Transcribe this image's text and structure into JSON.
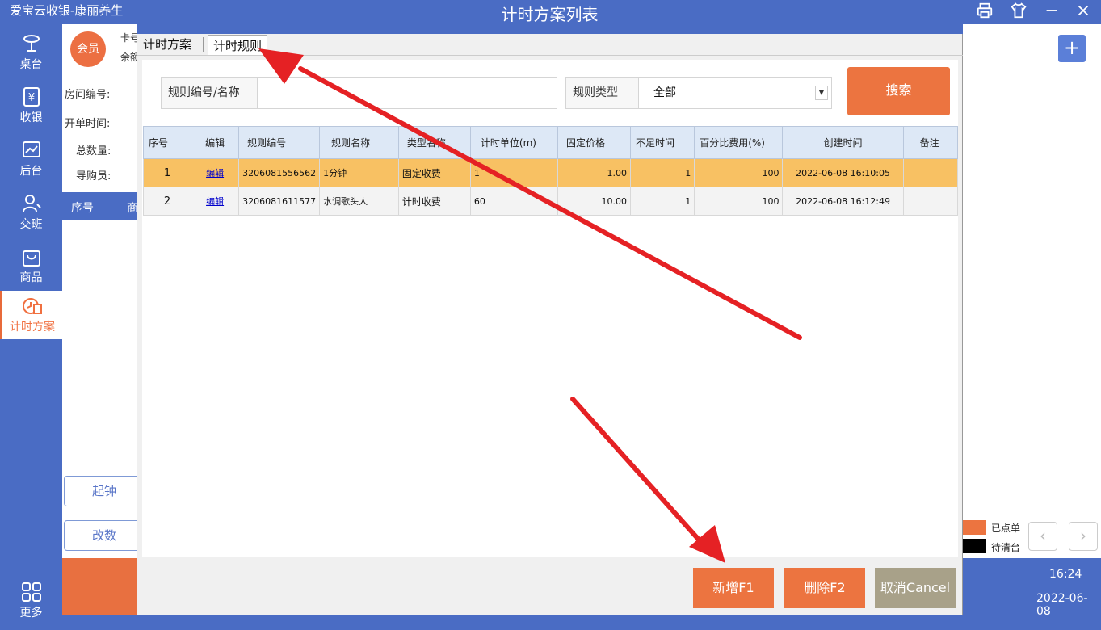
{
  "app_title": "爱宝云收银-康丽养生",
  "sidebar": {
    "items": [
      "桌台",
      "收银",
      "后台",
      "交班",
      "商品",
      "计时方案"
    ],
    "more": "更多"
  },
  "left_panel": {
    "member_label": "会员",
    "card_label": "卡号",
    "balance_label": "余额",
    "room_label": "房间编号:",
    "open_time_label": "开单时间:",
    "total_label": "总数量:",
    "guide_label": "导购员:",
    "col_index": "序号",
    "col_goods": "商",
    "btn_start": "起钟",
    "btn_modify": "改数"
  },
  "dialog": {
    "title": "计时方案列表",
    "tabs": [
      "计时方案",
      "计时规则"
    ],
    "search_label": "规则编号/名称",
    "search_value": "",
    "type_label": "规则类型",
    "type_value": "全部",
    "search_button": "搜索",
    "columns": [
      "序号",
      "编辑",
      "规则编号",
      "规则名称",
      "类型名称",
      "计时单位(m)",
      "固定价格",
      "不足时间",
      "百分比费用(%)",
      "创建时间",
      "备注"
    ],
    "rows": [
      {
        "index": "1",
        "edit": "编辑",
        "code": "3206081556562",
        "name": "1分钟",
        "type": "固定收费",
        "unit": "1",
        "price": "1.00",
        "short_time": "1",
        "percent": "100",
        "created": "2022-06-08 16:10:05",
        "note": ""
      },
      {
        "index": "2",
        "edit": "编辑",
        "code": "3206081611577",
        "name": "水调歌头人",
        "type": "计时收费",
        "unit": "60",
        "price": "10.00",
        "short_time": "1",
        "percent": "100",
        "created": "2022-06-08 16:12:49",
        "note": ""
      }
    ],
    "btn_add": "新增F1",
    "btn_delete": "删除F2",
    "btn_cancel": "取消Cancel"
  },
  "right": {
    "legend": [
      {
        "label": "已点单",
        "color": "#ec7440"
      },
      {
        "label": "待清台",
        "color": "#000000"
      }
    ],
    "time": "16:24",
    "date": "2022-06-08"
  },
  "colors": {
    "brand_blue": "#4a6cc4",
    "accent_orange": "#ec7440",
    "selected_row": "#f8c163",
    "cancel_gray": "#a8a189",
    "arrow_red": "#e52124"
  }
}
